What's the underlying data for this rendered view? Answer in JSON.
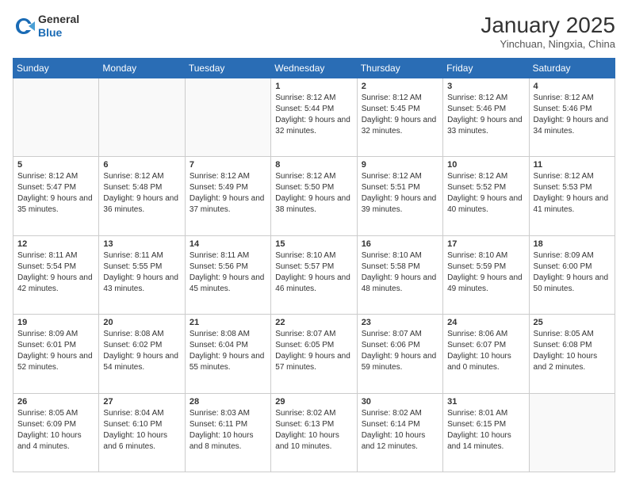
{
  "logo": {
    "general": "General",
    "blue": "Blue"
  },
  "header": {
    "month": "January 2025",
    "location": "Yinchuan, Ningxia, China"
  },
  "weekdays": [
    "Sunday",
    "Monday",
    "Tuesday",
    "Wednesday",
    "Thursday",
    "Friday",
    "Saturday"
  ],
  "weeks": [
    [
      {
        "day": "",
        "sunrise": "",
        "sunset": "",
        "daylight": ""
      },
      {
        "day": "",
        "sunrise": "",
        "sunset": "",
        "daylight": ""
      },
      {
        "day": "",
        "sunrise": "",
        "sunset": "",
        "daylight": ""
      },
      {
        "day": "1",
        "sunrise": "8:12 AM",
        "sunset": "5:44 PM",
        "daylight": "9 hours and 32 minutes."
      },
      {
        "day": "2",
        "sunrise": "8:12 AM",
        "sunset": "5:45 PM",
        "daylight": "9 hours and 32 minutes."
      },
      {
        "day": "3",
        "sunrise": "8:12 AM",
        "sunset": "5:46 PM",
        "daylight": "9 hours and 33 minutes."
      },
      {
        "day": "4",
        "sunrise": "8:12 AM",
        "sunset": "5:46 PM",
        "daylight": "9 hours and 34 minutes."
      }
    ],
    [
      {
        "day": "5",
        "sunrise": "8:12 AM",
        "sunset": "5:47 PM",
        "daylight": "9 hours and 35 minutes."
      },
      {
        "day": "6",
        "sunrise": "8:12 AM",
        "sunset": "5:48 PM",
        "daylight": "9 hours and 36 minutes."
      },
      {
        "day": "7",
        "sunrise": "8:12 AM",
        "sunset": "5:49 PM",
        "daylight": "9 hours and 37 minutes."
      },
      {
        "day": "8",
        "sunrise": "8:12 AM",
        "sunset": "5:50 PM",
        "daylight": "9 hours and 38 minutes."
      },
      {
        "day": "9",
        "sunrise": "8:12 AM",
        "sunset": "5:51 PM",
        "daylight": "9 hours and 39 minutes."
      },
      {
        "day": "10",
        "sunrise": "8:12 AM",
        "sunset": "5:52 PM",
        "daylight": "9 hours and 40 minutes."
      },
      {
        "day": "11",
        "sunrise": "8:12 AM",
        "sunset": "5:53 PM",
        "daylight": "9 hours and 41 minutes."
      }
    ],
    [
      {
        "day": "12",
        "sunrise": "8:11 AM",
        "sunset": "5:54 PM",
        "daylight": "9 hours and 42 minutes."
      },
      {
        "day": "13",
        "sunrise": "8:11 AM",
        "sunset": "5:55 PM",
        "daylight": "9 hours and 43 minutes."
      },
      {
        "day": "14",
        "sunrise": "8:11 AM",
        "sunset": "5:56 PM",
        "daylight": "9 hours and 45 minutes."
      },
      {
        "day": "15",
        "sunrise": "8:10 AM",
        "sunset": "5:57 PM",
        "daylight": "9 hours and 46 minutes."
      },
      {
        "day": "16",
        "sunrise": "8:10 AM",
        "sunset": "5:58 PM",
        "daylight": "9 hours and 48 minutes."
      },
      {
        "day": "17",
        "sunrise": "8:10 AM",
        "sunset": "5:59 PM",
        "daylight": "9 hours and 49 minutes."
      },
      {
        "day": "18",
        "sunrise": "8:09 AM",
        "sunset": "6:00 PM",
        "daylight": "9 hours and 50 minutes."
      }
    ],
    [
      {
        "day": "19",
        "sunrise": "8:09 AM",
        "sunset": "6:01 PM",
        "daylight": "9 hours and 52 minutes."
      },
      {
        "day": "20",
        "sunrise": "8:08 AM",
        "sunset": "6:02 PM",
        "daylight": "9 hours and 54 minutes."
      },
      {
        "day": "21",
        "sunrise": "8:08 AM",
        "sunset": "6:04 PM",
        "daylight": "9 hours and 55 minutes."
      },
      {
        "day": "22",
        "sunrise": "8:07 AM",
        "sunset": "6:05 PM",
        "daylight": "9 hours and 57 minutes."
      },
      {
        "day": "23",
        "sunrise": "8:07 AM",
        "sunset": "6:06 PM",
        "daylight": "9 hours and 59 minutes."
      },
      {
        "day": "24",
        "sunrise": "8:06 AM",
        "sunset": "6:07 PM",
        "daylight": "10 hours and 0 minutes."
      },
      {
        "day": "25",
        "sunrise": "8:05 AM",
        "sunset": "6:08 PM",
        "daylight": "10 hours and 2 minutes."
      }
    ],
    [
      {
        "day": "26",
        "sunrise": "8:05 AM",
        "sunset": "6:09 PM",
        "daylight": "10 hours and 4 minutes."
      },
      {
        "day": "27",
        "sunrise": "8:04 AM",
        "sunset": "6:10 PM",
        "daylight": "10 hours and 6 minutes."
      },
      {
        "day": "28",
        "sunrise": "8:03 AM",
        "sunset": "6:11 PM",
        "daylight": "10 hours and 8 minutes."
      },
      {
        "day": "29",
        "sunrise": "8:02 AM",
        "sunset": "6:13 PM",
        "daylight": "10 hours and 10 minutes."
      },
      {
        "day": "30",
        "sunrise": "8:02 AM",
        "sunset": "6:14 PM",
        "daylight": "10 hours and 12 minutes."
      },
      {
        "day": "31",
        "sunrise": "8:01 AM",
        "sunset": "6:15 PM",
        "daylight": "10 hours and 14 minutes."
      },
      {
        "day": "",
        "sunrise": "",
        "sunset": "",
        "daylight": ""
      }
    ]
  ]
}
